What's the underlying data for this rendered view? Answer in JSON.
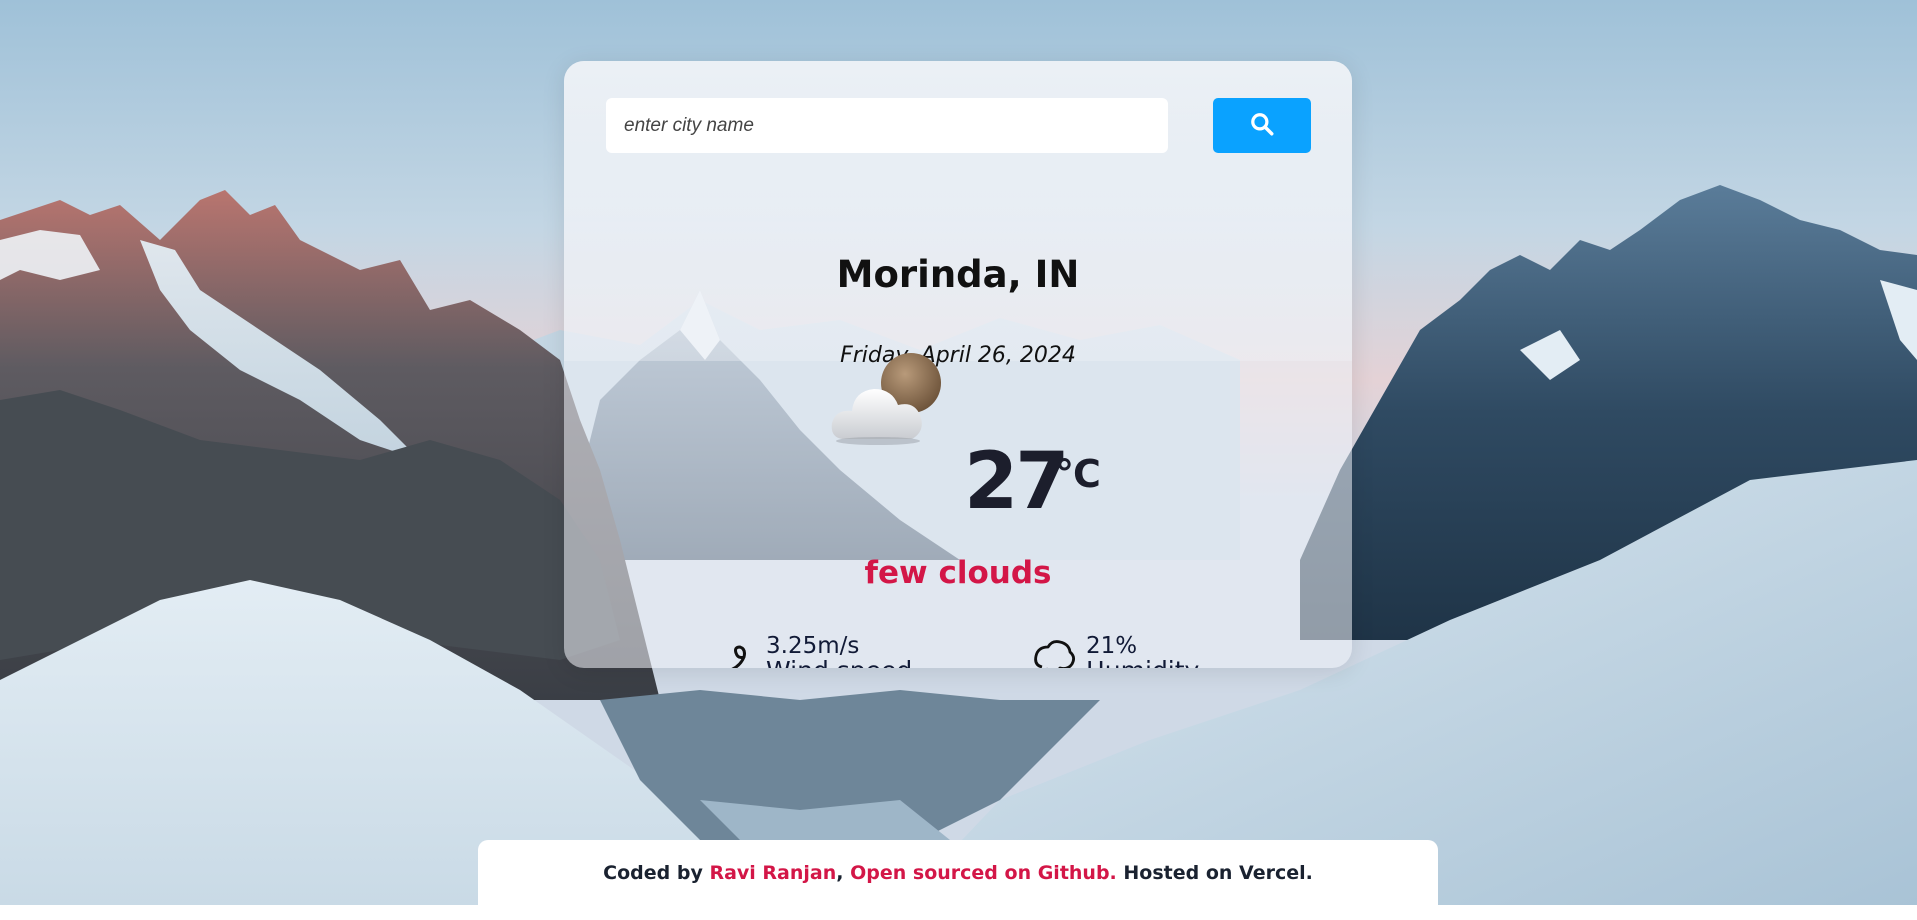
{
  "search": {
    "placeholder": "enter city name",
    "button_icon": "search-icon"
  },
  "location": {
    "city": "Morinda, IN",
    "date": "Friday, April 26, 2024"
  },
  "weather": {
    "icon": "few-clouds-night-icon",
    "temperature": "27",
    "unit": "°C",
    "description": "few clouds"
  },
  "stats": {
    "wind": {
      "icon": "wind-icon",
      "value": "3.25m/s",
      "label": "Wind speed"
    },
    "humidity": {
      "icon": "humidity-icon",
      "value": "21%",
      "label": "Humidity"
    }
  },
  "footer": {
    "prefix": "Coded by ",
    "author": "Ravi Ranjan",
    "separator": ", ",
    "repo_link": "Open sourced on Github.",
    "suffix": " Hosted on Vercel."
  },
  "colors": {
    "accent": "#d31647",
    "search_button": "#0aa2ff",
    "temperature": "#1c1e2c"
  }
}
